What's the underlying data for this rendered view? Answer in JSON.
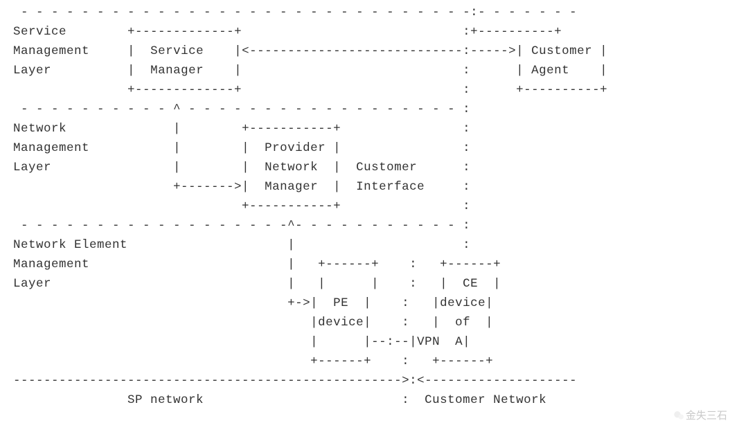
{
  "layers": {
    "service": "Service\nManagement\nLayer",
    "network": "Network\nManagement\nLayer",
    "element": "Network Element\nManagement\nLayer"
  },
  "boxes": {
    "service_manager": "Service\nManager",
    "customer_agent": "Customer\nAgent",
    "provider_network_manager": "Provider\nNetwork\nManager",
    "pe_device": "PE\ndevice",
    "ce_device": "CE\ndevice\nof\nVPN  A"
  },
  "labels": {
    "customer_interface": "Customer\nInterface",
    "sp_network": "SP network",
    "customer_network": "Customer Network"
  },
  "watermark": "金失三石",
  "lines": [
    " - - - - - - - - - - - - - - - - - - - - - - - - - - - - - - -:- - - - - - -",
    "Service        +-------------+                              :+----------+",
    "Management     |  Service    |<-----------------------------:----->| Customer |",
    "Layer          |  Manager    |                              :      | Agent    |",
    "               +-------------+                              :      +----------+",
    " - - - - - - - - - - ^ - - - - - - - - - - - - - - - - - - - :",
    "Network              |         +-----------+                :",
    "Management           |         |  Provider |                :",
    "Layer                |         |  Network  |  Customer      :",
    "                     +------->|  Manager   |  Interface     :",
    "                               +-----------+                :",
    " - - - - - - - - - - - - - - - - - - ^ - - - - - - - - - - - :",
    "Network Element                      |                       :",
    "Management                           |   +------+            :  +------+",
    "Layer                                |   |      |            :  |  CE  |",
    "                                     +->|  PE   |            :  |device|",
    "                                        |device |            :  |  of  |",
    "                                        |       |--:--|VPN  A|",
    "                                        +------+             :  +------+",
    "----------------------------------------------------------->:<---------------",
    "               SP network                                   :  Customer Network"
  ]
}
